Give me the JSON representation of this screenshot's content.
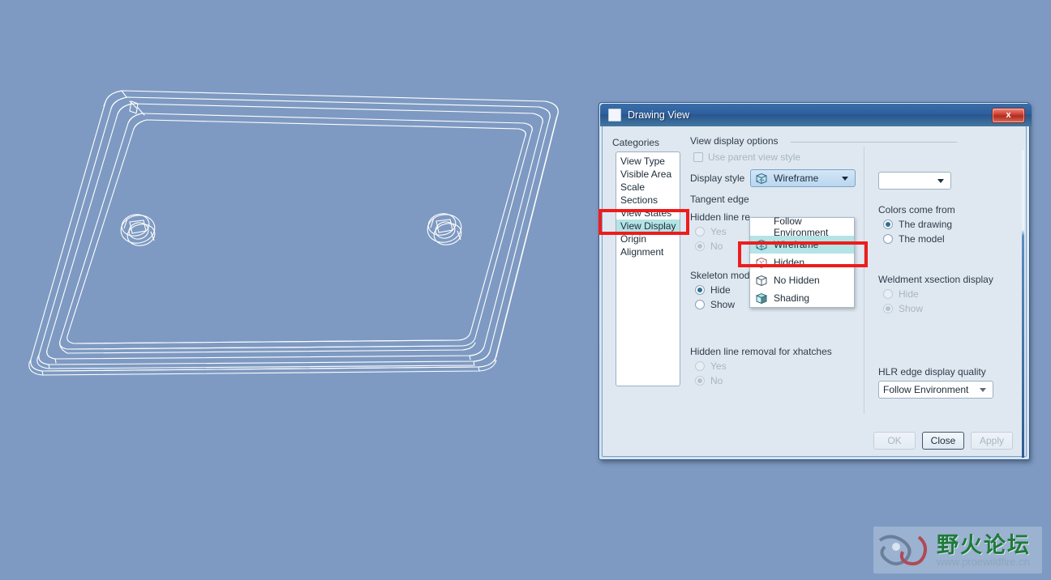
{
  "background": {
    "color": "#7e9ac2"
  },
  "drawing": {
    "description": "3D wireframe isometric view of a rounded rectangular tray / plate with two counterbored holes",
    "line_color": "#ffffff"
  },
  "dialog": {
    "title": "Drawing View",
    "title_icon": "window-icon",
    "close_label": "x",
    "categories_label": "Categories",
    "categories": [
      {
        "label": "View Type",
        "selected": false
      },
      {
        "label": "Visible Area",
        "selected": false
      },
      {
        "label": "Scale",
        "selected": false
      },
      {
        "label": "Sections",
        "selected": false
      },
      {
        "label": "View States",
        "selected": false
      },
      {
        "label": "View Display",
        "selected": true
      },
      {
        "label": "Origin",
        "selected": false
      },
      {
        "label": "Alignment",
        "selected": false
      }
    ],
    "view_display": {
      "group_title": "View display options",
      "use_parent_view_style": "Use parent view style",
      "display_style_label": "Display style",
      "display_style_value": "Wireframe",
      "display_style_icon": "wireframe-cube-icon",
      "tangent_edge_label": "Tangent edge",
      "tangent_edge_value": "",
      "hidden_line_label": "Hidden line re",
      "hidden_line_yes": "Yes",
      "hidden_line_no": "No",
      "skeleton_label": "Skeleton model display",
      "skeleton_hide": "Hide",
      "skeleton_show": "Show",
      "skeleton_selected": "Hide",
      "xhatch_label": "Hidden line removal for xhatches",
      "xhatch_yes": "Yes",
      "xhatch_no": "No",
      "xhatch_selected": "No",
      "colors_label": "Colors come from",
      "colors_drawing": "The drawing",
      "colors_model": "The model",
      "colors_selected": "The drawing",
      "weldment_label": "Weldment xsection display",
      "weldment_hide": "Hide",
      "weldment_show": "Show",
      "weldment_selected": "Show",
      "hlr_label": "HLR edge display quality",
      "hlr_value": "Follow Environment"
    },
    "dropdown": {
      "open": true,
      "items": [
        {
          "label": "Follow Environment",
          "icon": "none",
          "selected": false
        },
        {
          "label": "Wireframe",
          "icon": "wireframe-cube-icon",
          "selected": true
        },
        {
          "label": "Hidden",
          "icon": "hidden-cube-icon",
          "selected": false
        },
        {
          "label": "No Hidden",
          "icon": "no-hidden-cube-icon",
          "selected": false
        },
        {
          "label": "Shading",
          "icon": "shaded-cube-icon",
          "selected": false
        }
      ]
    },
    "buttons": {
      "ok": "OK",
      "close": "Close",
      "apply": "Apply"
    }
  },
  "annotations": {
    "highlight_color": "#ee1c1c",
    "boxes": [
      {
        "name": "view-display-category",
        "target": "View Display"
      },
      {
        "name": "no-hidden-option",
        "target": "No Hidden"
      }
    ]
  },
  "watermark": {
    "name_cn": "野火论坛",
    "url": "www.proewildfire.cn"
  }
}
